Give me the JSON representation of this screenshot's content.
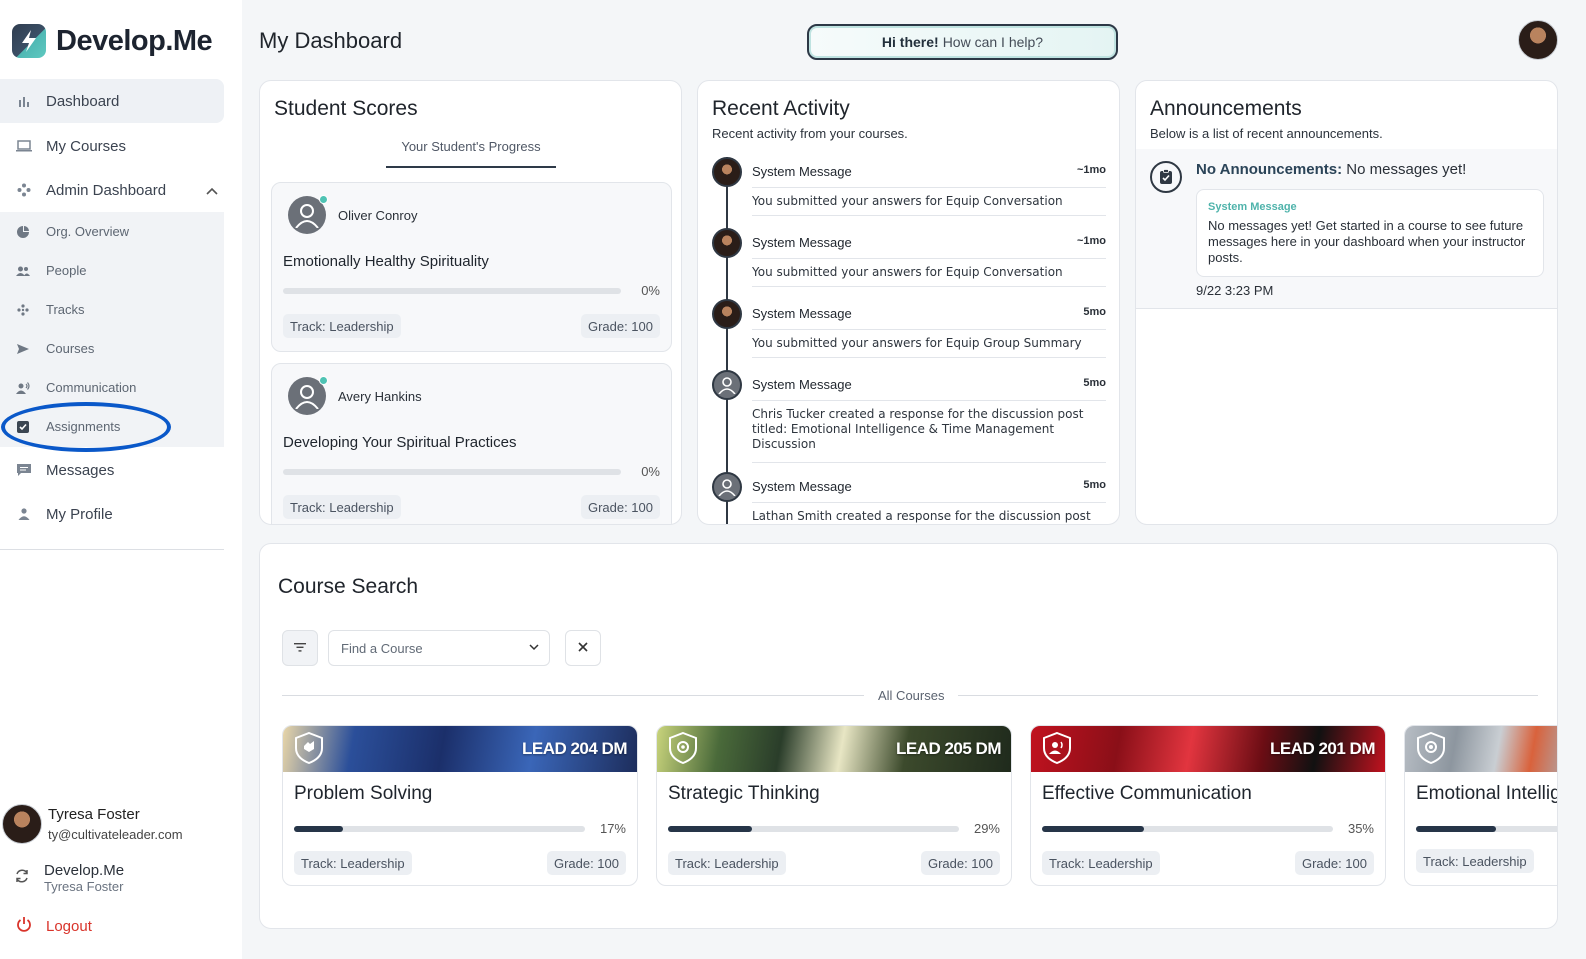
{
  "brand": {
    "name": "Develop.Me"
  },
  "sidebar": {
    "items": [
      {
        "label": "Dashboard",
        "icon": "bar-chart-icon"
      },
      {
        "label": "My Courses",
        "icon": "laptop-icon"
      },
      {
        "label": "Admin Dashboard",
        "icon": "admin-icon"
      }
    ],
    "admin_items": [
      {
        "label": "Org. Overview",
        "icon": "pie-chart-icon"
      },
      {
        "label": "People",
        "icon": "people-icon"
      },
      {
        "label": "Tracks",
        "icon": "tracks-icon"
      },
      {
        "label": "Courses",
        "icon": "send-icon"
      },
      {
        "label": "Communication",
        "icon": "communication-icon"
      },
      {
        "label": "Assignments",
        "icon": "checkbox-icon"
      }
    ],
    "bottom_items": [
      {
        "label": "Messages",
        "icon": "message-icon"
      },
      {
        "label": "My Profile",
        "icon": "person-icon"
      }
    ],
    "user": {
      "name": "Tyresa Foster",
      "email": "ty@cultivateleader.com"
    },
    "org": {
      "name": "Develop.Me",
      "user": "Tyresa Foster"
    },
    "logout": "Logout"
  },
  "header": {
    "title": "My Dashboard",
    "help_bold": "Hi there!",
    "help_text": "How can I help?"
  },
  "student_scores": {
    "title": "Student Scores",
    "tab": "Your Student's Progress",
    "students": [
      {
        "name": "Oliver Conroy",
        "course": "Emotionally Healthy Spirituality",
        "progress": 0,
        "progress_label": "0%",
        "track": "Track: Leadership",
        "grade": "Grade: 100"
      },
      {
        "name": "Avery Hankins",
        "course": "Developing Your Spiritual Practices",
        "progress": 0,
        "progress_label": "0%",
        "track": "Track: Leadership",
        "grade": "Grade: 100"
      }
    ]
  },
  "recent_activity": {
    "title": "Recent Activity",
    "subtitle": "Recent activity from your courses.",
    "items": [
      {
        "from": "System Message",
        "time": "~1mo",
        "text": "You submitted your answers for Equip Conversation",
        "icon": "photo"
      },
      {
        "from": "System Message",
        "time": "~1mo",
        "text": "You submitted your answers for Equip Conversation",
        "icon": "photo"
      },
      {
        "from": "System Message",
        "time": "5mo",
        "text": "You submitted your answers for Equip Group Summary",
        "icon": "photo"
      },
      {
        "from": "System Message",
        "time": "5mo",
        "text": "Chris Tucker created a response for the discussion post titled: Emotional Intelligence & Time Management Discussion",
        "icon": "generic"
      },
      {
        "from": "System Message",
        "time": "5mo",
        "text": "Lathan Smith created a response for the discussion post",
        "icon": "generic"
      }
    ]
  },
  "announcements": {
    "title": "Announcements",
    "subtitle": "Below is a list of recent announcements.",
    "head_bold": "No Announcements:",
    "head_text": "No messages yet!",
    "box_tag": "System Message",
    "box_text": "No messages yet! Get started in a course to see future messages here in your dashboard when your instructor posts.",
    "date": "9/22 3:23 PM"
  },
  "course_search": {
    "title": "Course Search",
    "placeholder": "Find a Course",
    "divider_label": "All Courses",
    "courses": [
      {
        "code": "LEAD 204 DM",
        "title": "Problem Solving",
        "progress": 17,
        "progress_label": "17%",
        "track": "Track: Leadership",
        "grade": "Grade: 100",
        "banner": "#1f3a6e"
      },
      {
        "code": "LEAD 205 DM",
        "title": "Strategic Thinking",
        "progress": 29,
        "progress_label": "29%",
        "track": "Track: Leadership",
        "grade": "Grade: 100",
        "banner": "#3c4a2c"
      },
      {
        "code": "LEAD 201 DM",
        "title": "Effective Communication",
        "progress": 35,
        "progress_label": "35%",
        "track": "Track: Leadership",
        "grade": "Grade: 100",
        "banner": "#b21f2a"
      },
      {
        "code": "",
        "title": "Emotional Intellige",
        "progress": 40,
        "progress_label": "",
        "track": "Track: Leadership",
        "grade": "",
        "banner": "#9aa3ad"
      }
    ]
  },
  "colors": {
    "accent": "#4fb8b4",
    "dark": "#263548",
    "logout": "#d9342b",
    "annotation": "#0a58c9"
  }
}
